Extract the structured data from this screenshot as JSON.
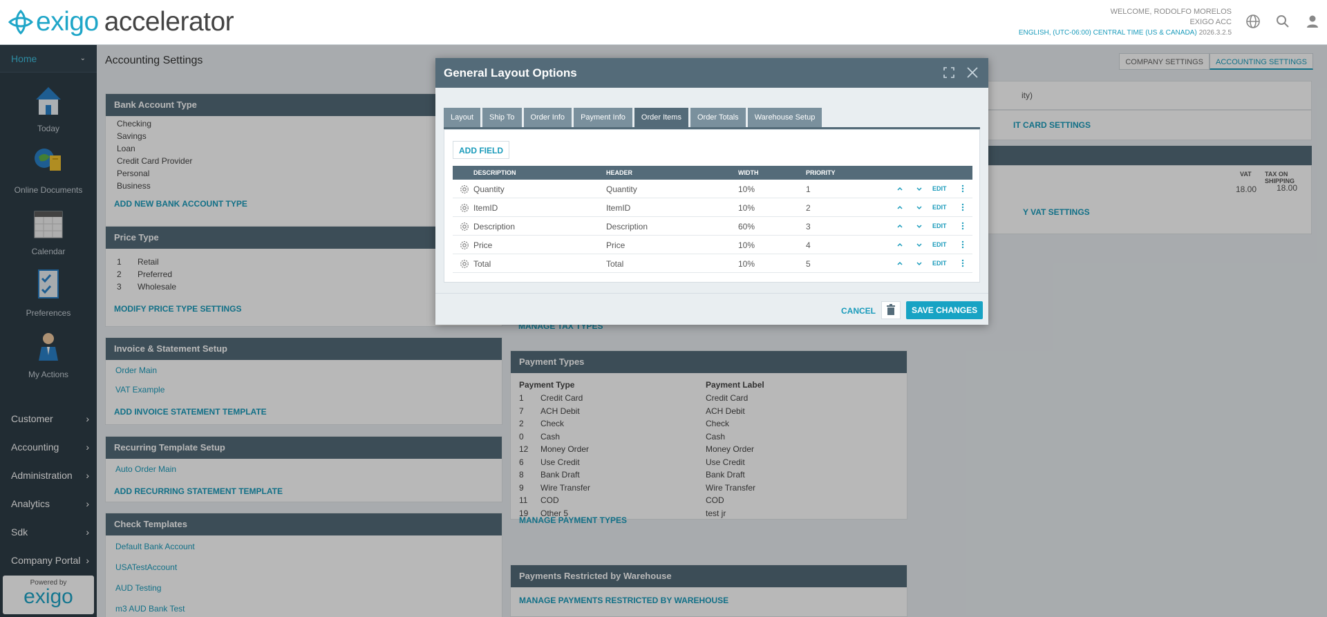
{
  "header": {
    "logo_prefix": "exigo",
    "logo_suffix": "accelerator",
    "welcome": "WELCOME, RODOLFO MORELOS",
    "company": "EXIGO ACC",
    "locale": "ENGLISH, (UTC-06:00) CENTRAL TIME (US & CANADA)",
    "version": "2026.3.2.5"
  },
  "sidebar": {
    "home": "Home",
    "tiles": [
      "Today",
      "Online Documents",
      "Calendar",
      "Preferences",
      "My Actions"
    ],
    "nav": [
      "Customer",
      "Accounting",
      "Administration",
      "Analytics",
      "Sdk",
      "Company Portal"
    ],
    "powered_by": "Powered by",
    "powered_logo": "exigo"
  },
  "page": {
    "title": "Accounting Settings",
    "tabs": [
      "COMPANY SETTINGS",
      "ACCOUNTING SETTINGS"
    ],
    "bank_account_type": {
      "title": "Bank Account Type",
      "items": [
        "Checking",
        "Savings",
        "Loan",
        "Credit Card Provider",
        "Personal",
        "Business"
      ],
      "link": "ADD NEW BANK ACCOUNT TYPE"
    },
    "price_type": {
      "title": "Price Type",
      "items": [
        {
          "id": "1",
          "name": "Retail"
        },
        {
          "id": "2",
          "name": "Preferred"
        },
        {
          "id": "3",
          "name": "Wholesale"
        }
      ],
      "link": "MODIFY PRICE TYPE SETTINGS"
    },
    "invoice": {
      "title": "Invoice & Statement Setup",
      "items": [
        "Order Main",
        "VAT Example"
      ],
      "link": "ADD INVOICE STATEMENT TEMPLATE"
    },
    "recurring": {
      "title": "Recurring Template Setup",
      "items": [
        "Auto Order Main"
      ],
      "link": "ADD RECURRING STATEMENT TEMPLATE"
    },
    "check_templates": {
      "title": "Check Templates",
      "items": [
        "Default Bank Account",
        "USATestAccount",
        "AUD Testing",
        "m3 AUD Bank Test"
      ]
    },
    "tax": {
      "link": "MANAGE TAX TYPES"
    },
    "payment_types": {
      "title": "Payment Types",
      "col1": "Payment Type",
      "col2": "Payment Label",
      "rows": [
        {
          "id": "1",
          "type": "Credit Card",
          "label": "Credit Card"
        },
        {
          "id": "7",
          "type": "ACH Debit",
          "label": "ACH Debit"
        },
        {
          "id": "2",
          "type": "Check",
          "label": "Check"
        },
        {
          "id": "0",
          "type": "Cash",
          "label": "Cash"
        },
        {
          "id": "12",
          "type": "Money Order",
          "label": "Money Order"
        },
        {
          "id": "6",
          "type": "Use Credit",
          "label": "Use Credit"
        },
        {
          "id": "8",
          "type": "Bank Draft",
          "label": "Bank Draft"
        },
        {
          "id": "9",
          "type": "Wire Transfer",
          "label": "Wire Transfer"
        },
        {
          "id": "11",
          "type": "COD",
          "label": "COD"
        },
        {
          "id": "19",
          "type": "Other 5",
          "label": "test jr"
        }
      ],
      "link": "MANAGE PAYMENT TYPES"
    },
    "restricted": {
      "title": "Payments Restricted by Warehouse",
      "link": "MANAGE PAYMENTS RESTRICTED BY WAREHOUSE"
    },
    "right_panel": {
      "partial_text": "ity)",
      "card_link": "IT CARD SETTINGS",
      "vat": "VAT",
      "tax_on_shipping": "TAX ON SHIPPING",
      "vat_value": "18.00",
      "shipping_value": "18.00",
      "vat_link": "Y VAT SETTINGS"
    }
  },
  "modal": {
    "title": "General Layout Options",
    "tabs": [
      "Layout",
      "Ship To",
      "Order Info",
      "Payment Info",
      "Order Items",
      "Order Totals",
      "Warehouse Setup"
    ],
    "active_tab": "Order Items",
    "add_field": "ADD FIELD",
    "columns": [
      "DESCRIPTION",
      "HEADER",
      "WIDTH",
      "PRIORITY"
    ],
    "rows": [
      {
        "description": "Quantity",
        "header": "Quantity",
        "width": "10%",
        "priority": "1"
      },
      {
        "description": "ItemID",
        "header": "ItemID",
        "width": "10%",
        "priority": "2"
      },
      {
        "description": "Description",
        "header": "Description",
        "width": "60%",
        "priority": "3"
      },
      {
        "description": "Price",
        "header": "Price",
        "width": "10%",
        "priority": "4"
      },
      {
        "description": "Total",
        "header": "Total",
        "width": "10%",
        "priority": "5"
      }
    ],
    "edit_label": "EDIT",
    "cancel": "CANCEL",
    "save": "SAVE CHANGES"
  },
  "colors": {
    "accent": "#1a9bbb",
    "panel_header": "#546b79",
    "sidebar": "#2f3d47"
  }
}
